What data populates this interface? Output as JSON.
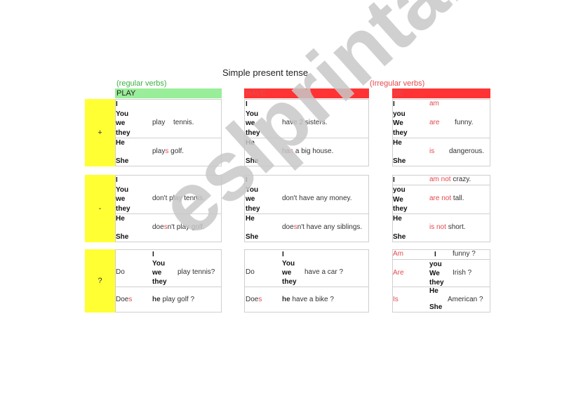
{
  "title": "Simple present tense",
  "notes": {
    "regular": "(regular verbs)",
    "irregular": "(Irregular verbs)"
  },
  "colors": {
    "green_header": "#99ee99",
    "red_header": "#ff3333",
    "side": "#ffff33",
    "accent_red": "#e5484d",
    "accent_green": "#3cb043"
  },
  "side_labels": {
    "positive": "+",
    "negative": "-",
    "question": "?"
  },
  "headers": {
    "play": "PLAY",
    "have": "HAVE",
    "be": "BE"
  },
  "pronouns": {
    "i": "I",
    "you": "You",
    "you_lc": "you",
    "we": "we",
    "we_cap": "We",
    "they": "they",
    "he": "He",
    "she": "She",
    "he_lc": "he"
  },
  "play": {
    "pos1": [
      "play",
      "tennis."
    ],
    "pos2_base": "play",
    "pos2_suffix": "s",
    "pos2_rest": "golf.",
    "neg1": "don't play tennis.",
    "neg2_a": "doe",
    "neg2_s": "s",
    "neg2_b": "n't play golf.",
    "q1_aux": "Do",
    "q1_rest": "play  tennis?",
    "q2_aux": "Doe",
    "q2_s": "s",
    "q2_rest": "play  golf ?"
  },
  "have": {
    "pos1": "have 2 sisters.",
    "pos2_base": "ha",
    "pos2_suffix": "s",
    "pos2_rest": "a big house.",
    "neg1": "don't have any money.",
    "neg2_a": "doe",
    "neg2_s": "s",
    "neg2_b": "n't have any siblings.",
    "q1_aux": "Do",
    "q1_rest": "have  a car  ?",
    "q2_aux": "Doe",
    "q2_s": "s",
    "q2_rest": "have a bike  ?"
  },
  "be": {
    "am": "am",
    "are": "are",
    "is": "is",
    "funny": "funny.",
    "dangerous": "dangerous.",
    "am_not": "am not",
    "crazy": "crazy.",
    "are_not": "are not",
    "tall": "tall.",
    "is_not": "is not",
    "short": "short.",
    "q_am": "Am",
    "q_funny": "funny ?",
    "q_are": "Are",
    "q_irish": "Irish ?",
    "q_is": "Is",
    "q_american": "American ?"
  },
  "watermark": "eslprintables.com"
}
